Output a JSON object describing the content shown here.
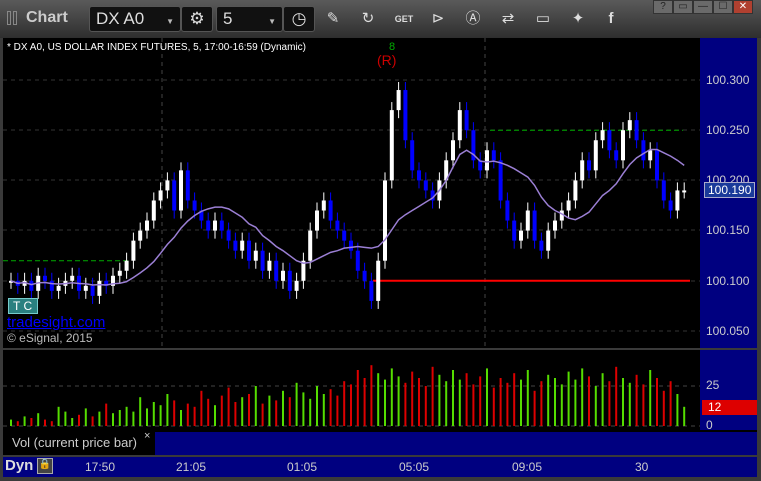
{
  "window": {
    "title": "Chart",
    "symbol": "DX A0",
    "interval": "5",
    "controls": [
      "?",
      "▭",
      "—",
      "☐",
      "✕"
    ]
  },
  "toolbar_icons": [
    "settings-icon",
    "clock-icon",
    "pencil-icon",
    "refresh-icon",
    "get-icon",
    "play-icon",
    "alert-icon",
    "link-icon",
    "comment-icon",
    "twitter-icon",
    "facebook-icon"
  ],
  "chart_header": "* DX A0, US DOLLAR INDEX FUTURES, 5, 17:00-16:59 (Dynamic)",
  "annotations": {
    "r_label": "(R)",
    "count_label": "8",
    "tc_label": "T C",
    "watermark": "tradesight.com",
    "copyright": "© eSignal, 2015"
  },
  "price_axis": {
    "ticks": [
      "100.300",
      "100.250",
      "100.200",
      "100.150",
      "100.100",
      "100.050"
    ],
    "current": "100.190"
  },
  "volume_axis": {
    "ticks": [
      "25",
      "0"
    ],
    "current": "12"
  },
  "volume_legend": "Vol (current price bar)",
  "close_symbol": "×",
  "time_axis": {
    "mode": "Dyn",
    "labels": [
      "17:50",
      "21:05",
      "01:05",
      "05:05",
      "09:05",
      "30"
    ]
  },
  "colors": {
    "up": "#ffffff",
    "down": "#0000ff",
    "vol_up": "#55dd00",
    "vol_down": "#dd0000",
    "ma": "#9b7fd4",
    "support": "#ff0000",
    "resistance": "#00aa00"
  },
  "chart_data": {
    "type": "candlestick",
    "ylim": [
      100.03,
      100.33
    ],
    "levels": {
      "green_left": 100.12,
      "green_right": 100.25,
      "red": 100.1
    },
    "closes": [
      100.1,
      100.095,
      100.1,
      100.09,
      100.105,
      100.1,
      100.09,
      100.095,
      100.1,
      100.105,
      100.09,
      100.095,
      100.085,
      100.1,
      100.095,
      100.105,
      100.11,
      100.12,
      100.14,
      100.15,
      100.16,
      100.18,
      100.19,
      100.2,
      100.17,
      100.21,
      100.18,
      100.17,
      100.16,
      100.15,
      100.16,
      100.15,
      100.14,
      100.13,
      100.14,
      100.12,
      100.13,
      100.11,
      100.12,
      100.1,
      100.11,
      100.09,
      100.1,
      100.12,
      100.15,
      100.17,
      100.18,
      100.16,
      100.15,
      100.14,
      100.13,
      100.11,
      100.1,
      100.08,
      100.12,
      100.2,
      100.27,
      100.29,
      100.24,
      100.21,
      100.2,
      100.19,
      100.18,
      100.2,
      100.22,
      100.24,
      100.27,
      100.25,
      100.22,
      100.21,
      100.23,
      100.22,
      100.18,
      100.16,
      100.14,
      100.15,
      100.17,
      100.14,
      100.13,
      100.15,
      100.16,
      100.17,
      100.18,
      100.2,
      100.22,
      100.21,
      100.24,
      100.25,
      100.23,
      100.22,
      100.25,
      100.26,
      100.24,
      100.22,
      100.23,
      100.2,
      100.18,
      100.17,
      100.19,
      100.19
    ],
    "volumes": [
      4,
      3,
      6,
      5,
      8,
      4,
      3,
      12,
      9,
      5,
      7,
      11,
      6,
      9,
      14,
      8,
      10,
      12,
      9,
      18,
      11,
      15,
      13,
      20,
      16,
      10,
      14,
      12,
      22,
      17,
      13,
      19,
      24,
      15,
      18,
      20,
      25,
      14,
      19,
      16,
      22,
      18,
      27,
      21,
      17,
      25,
      20,
      23,
      19,
      28,
      26,
      35,
      30,
      38,
      33,
      29,
      36,
      31,
      27,
      34,
      30,
      25,
      37,
      32,
      28,
      35,
      29,
      33,
      26,
      31,
      36,
      24,
      30,
      27,
      33,
      29,
      35,
      22,
      28,
      32,
      30,
      26,
      34,
      29,
      36,
      31,
      25,
      33,
      28,
      37,
      30,
      27,
      32,
      26,
      35,
      30,
      22,
      28,
      20,
      12
    ]
  }
}
